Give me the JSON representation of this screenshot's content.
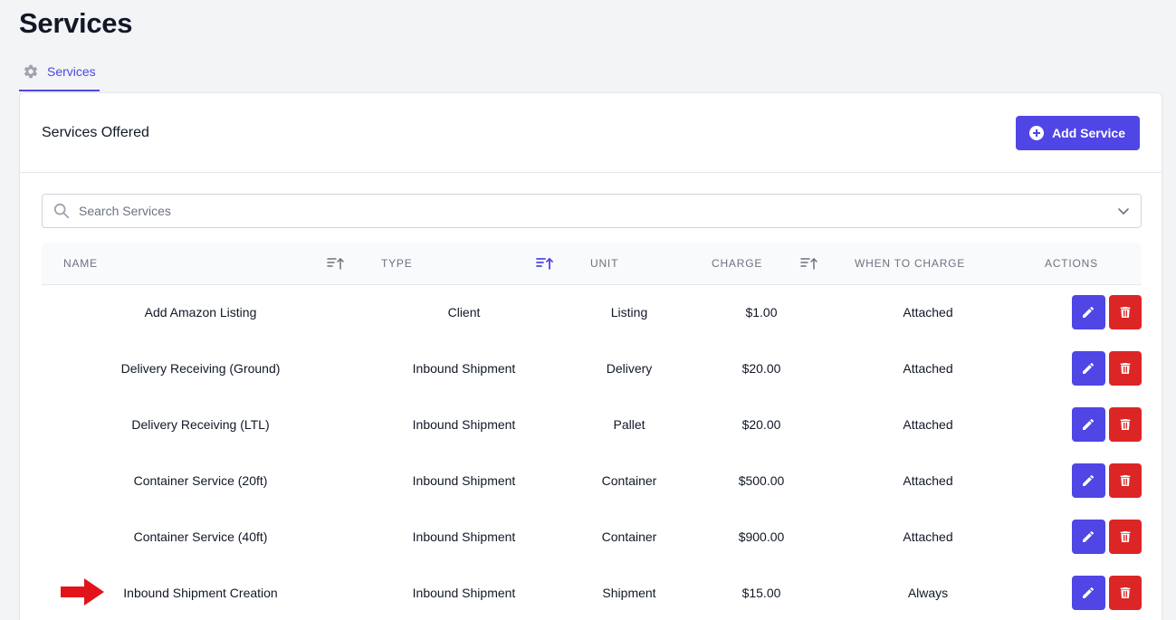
{
  "page": {
    "title": "Services"
  },
  "tabs": [
    {
      "label": "Services",
      "icon": "gear-icon",
      "active": true
    }
  ],
  "card": {
    "title": "Services Offered",
    "add_button": {
      "label": "Add Service",
      "icon": "plus-circle-icon"
    }
  },
  "search": {
    "placeholder": "Search Services",
    "value": ""
  },
  "table": {
    "columns": [
      {
        "label": "Name",
        "sortable": true
      },
      {
        "label": "Type",
        "sortable": true,
        "active": true
      },
      {
        "label": "Unit",
        "sortable": false
      },
      {
        "label": "Charge",
        "sortable": true
      },
      {
        "label": "When to Charge",
        "sortable": false
      },
      {
        "label": "Actions",
        "sortable": false
      }
    ],
    "rows": [
      {
        "name": "Add Amazon Listing",
        "type": "Client",
        "unit": "Listing",
        "charge": "$1.00",
        "when": "Attached"
      },
      {
        "name": "Delivery Receiving (Ground)",
        "type": "Inbound Shipment",
        "unit": "Delivery",
        "charge": "$20.00",
        "when": "Attached"
      },
      {
        "name": "Delivery Receiving (LTL)",
        "type": "Inbound Shipment",
        "unit": "Pallet",
        "charge": "$20.00",
        "when": "Attached"
      },
      {
        "name": "Container Service (20ft)",
        "type": "Inbound Shipment",
        "unit": "Container",
        "charge": "$500.00",
        "when": "Attached"
      },
      {
        "name": "Container Service (40ft)",
        "type": "Inbound Shipment",
        "unit": "Container",
        "charge": "$900.00",
        "when": "Attached"
      },
      {
        "name": "Inbound Shipment Creation",
        "type": "Inbound Shipment",
        "unit": "Shipment",
        "charge": "$15.00",
        "when": "Always"
      }
    ]
  },
  "colors": {
    "accent": "#4f46e5",
    "danger": "#dc2626",
    "annotation_arrow": "#e3131b"
  }
}
